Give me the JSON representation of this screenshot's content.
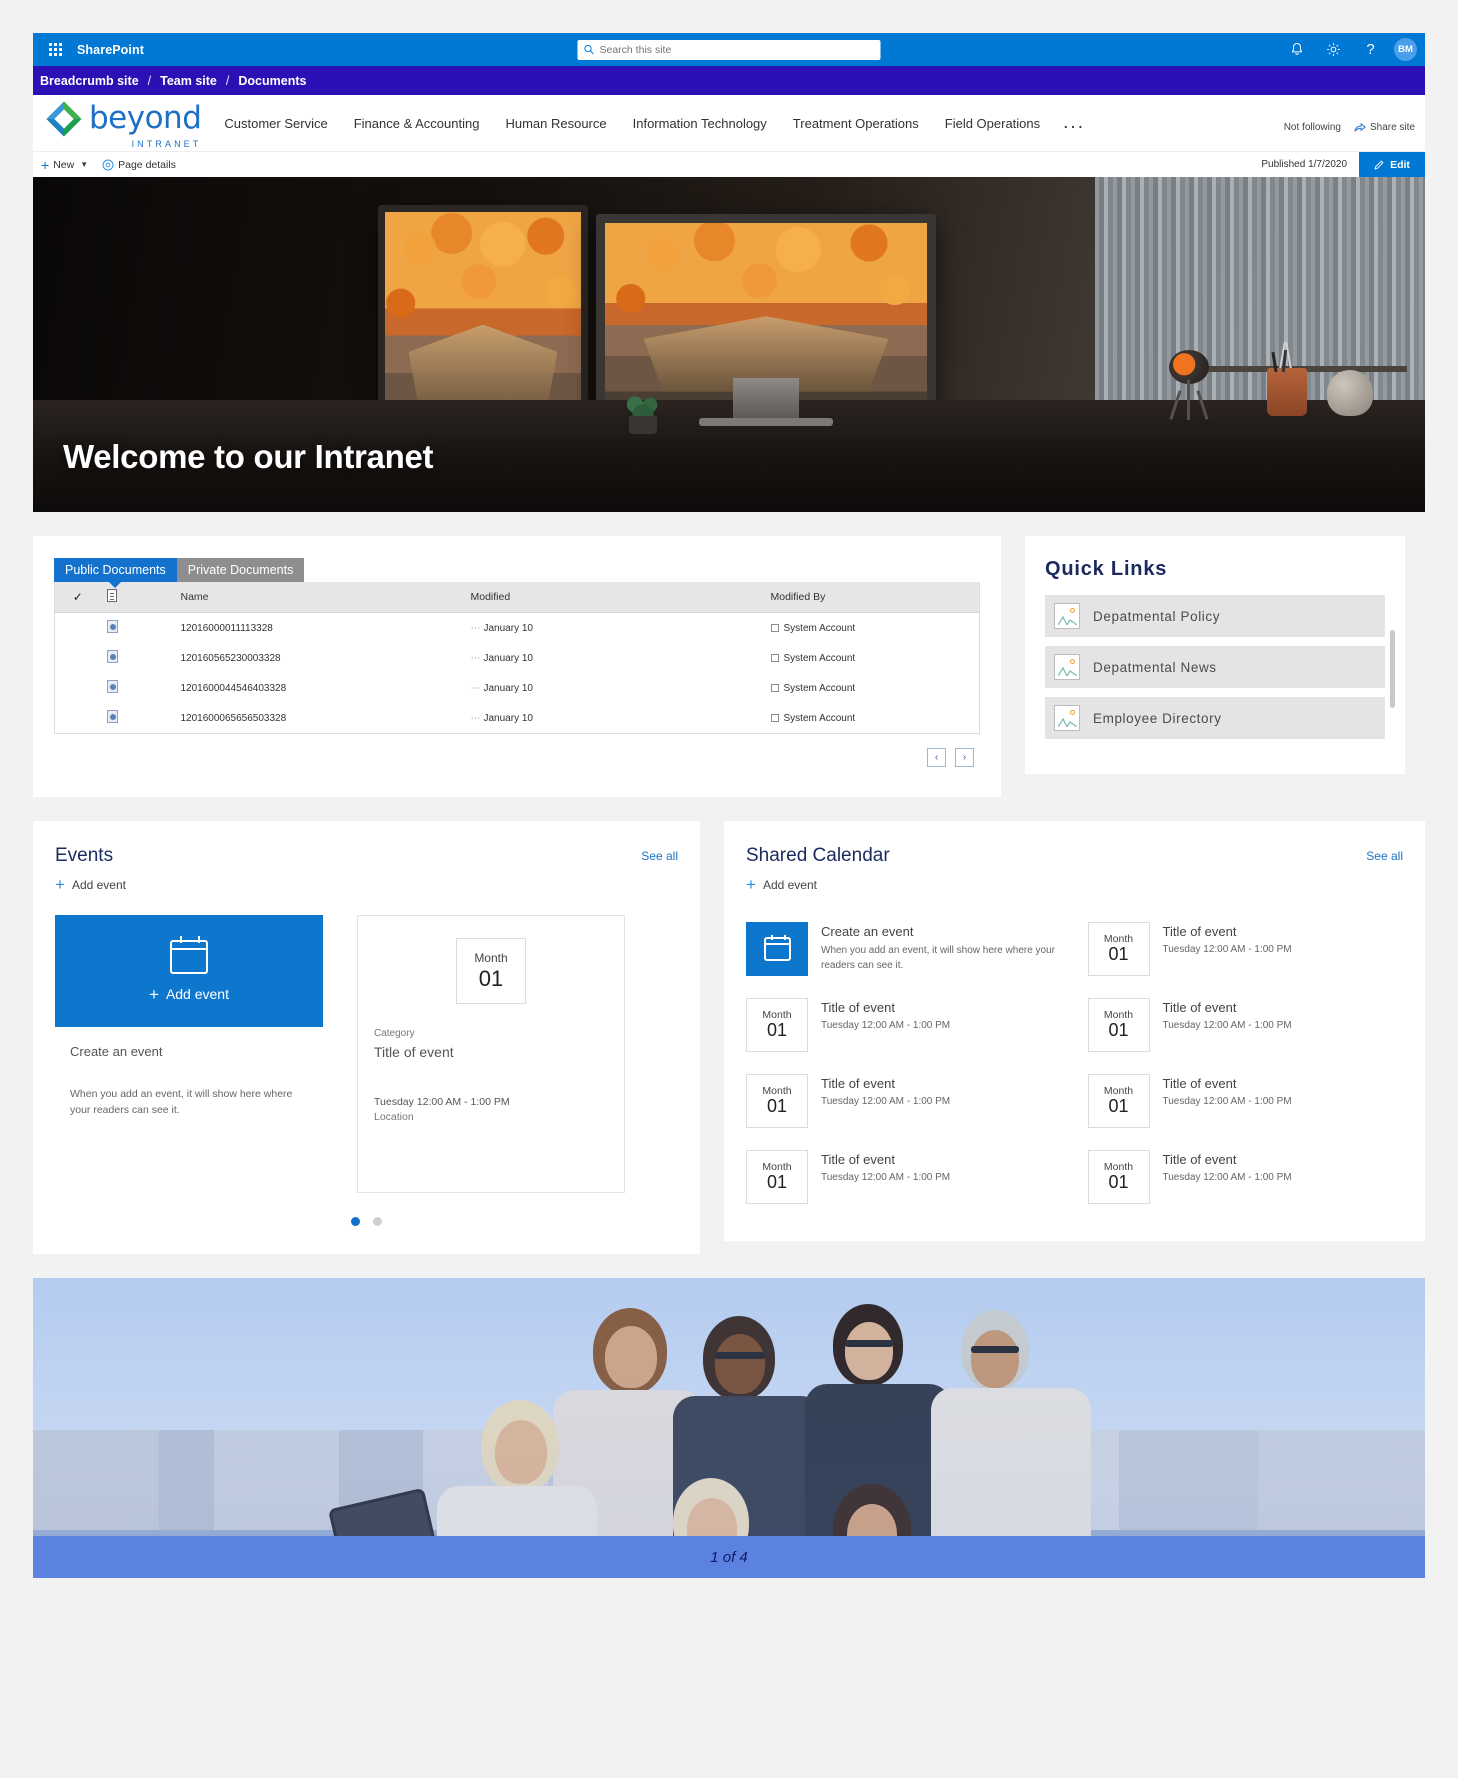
{
  "suitebar": {
    "app_launcher": "waffle-icon",
    "brand": "SharePoint",
    "search_placeholder": "Search this site",
    "notifications_icon": "bell-icon",
    "settings_icon": "gear-icon",
    "help_icon": "help-icon",
    "help_label": "?",
    "avatar_initials": "BM"
  },
  "breadcrumb": {
    "items": [
      "Breadcrumb site",
      "Team site",
      "Documents"
    ],
    "separator": "/"
  },
  "site_header": {
    "logo_word": "beyond",
    "logo_sub": "INTRANET",
    "nav": [
      "Customer Service",
      "Finance & Accounting",
      "Human Resource",
      "Information Technology",
      "Treatment Operations",
      "Field Operations"
    ],
    "overflow": "...",
    "follow_label": "Not following",
    "share_label": "Share site"
  },
  "command_bar": {
    "new_label": "New",
    "new_caret": "⌄",
    "page_details_label": "Page details",
    "published_label": "Published 1/7/2020",
    "edit_label": "Edit"
  },
  "hero": {
    "title": "Welcome to our Intranet"
  },
  "documents": {
    "tabs": [
      {
        "label": "Public Documents",
        "active": true
      },
      {
        "label": "Private Documents",
        "active": false
      }
    ],
    "columns": [
      "",
      "",
      "Name",
      "Modified",
      "Modified By"
    ],
    "rows": [
      {
        "name": "12016000011113328",
        "modified": "January 10",
        "modified_by": "System Account"
      },
      {
        "name": "120160565230003328",
        "modified": "January 10",
        "modified_by": "System Account"
      },
      {
        "name": "1201600044546403328",
        "modified": "January 10",
        "modified_by": "System Account"
      },
      {
        "name": "1201600065656503328",
        "modified": "January 10",
        "modified_by": "System Account"
      }
    ],
    "prev_label": "‹",
    "next_label": "›"
  },
  "quick_links": {
    "title": "Quick Links",
    "items": [
      {
        "label": "Depatmental Policy"
      },
      {
        "label": "Depatmental News"
      },
      {
        "label": "Employee Directory"
      }
    ]
  },
  "events": {
    "title": "Events",
    "see_all": "See all",
    "add_event": "Add event",
    "card_primary": {
      "add_label": "Add event",
      "create_title": "Create an event",
      "description": "When you add an event, it will show here where your readers can see it."
    },
    "card_second": {
      "month": "Month",
      "day": "01",
      "category": "Category",
      "title": "Title of event",
      "time": "Tuesday 12:00 AM - 1:00 PM",
      "location": "Location"
    },
    "dots": [
      true,
      false
    ]
  },
  "shared_calendar": {
    "title": "Shared Calendar",
    "see_all": "See all",
    "add_event": "Add event",
    "cells": [
      {
        "kind": "create",
        "title": "Create an event",
        "description": "When you add an event, it will show here where your readers can see it."
      },
      {
        "kind": "event",
        "month": "Month",
        "day": "01",
        "title": "Title of event",
        "time": "Tuesday 12:00 AM - 1:00 PM"
      },
      {
        "kind": "event",
        "month": "Month",
        "day": "01",
        "title": "Title of event",
        "time": "Tuesday 12:00 AM - 1:00 PM"
      },
      {
        "kind": "event",
        "month": "Month",
        "day": "01",
        "title": "Title of event",
        "time": "Tuesday 12:00 AM - 1:00 PM"
      },
      {
        "kind": "event",
        "month": "Month",
        "day": "01",
        "title": "Title of event",
        "time": "Tuesday 12:00 AM - 1:00 PM"
      },
      {
        "kind": "event",
        "month": "Month",
        "day": "01",
        "title": "Title of event",
        "time": "Tuesday 12:00 AM - 1:00 PM"
      },
      {
        "kind": "event",
        "month": "Month",
        "day": "01",
        "title": "Title of event",
        "time": "Tuesday 12:00 AM - 1:00 PM"
      },
      {
        "kind": "event",
        "month": "Month",
        "day": "01",
        "title": "Title of event",
        "time": "Tuesday 12:00 AM - 1:00 PM"
      }
    ]
  },
  "banner": {
    "pager_label": "1 of 4"
  },
  "colors": {
    "suitebar_blue": "#0078d4",
    "breadcrumb_purple": "#2b10b5",
    "accent_blue": "#1272ce",
    "heading_navy": "#1b2a5e",
    "link_blue": "#1a72c4",
    "tab_inactive_gray": "#8e8e8e",
    "banner_pager_blue": "#5b82e0"
  }
}
